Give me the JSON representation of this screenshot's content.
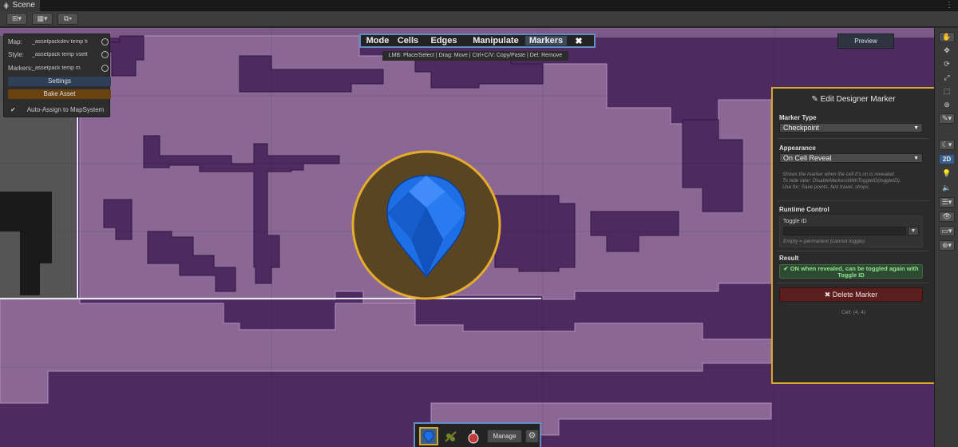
{
  "window": {
    "tab_title": "Scene",
    "tab_icon": "grid-icon",
    "menu_icon": "kebab-icon"
  },
  "map_panel": {
    "rows": [
      {
        "label": "Map:",
        "value": "_assetpackdev temp fi"
      },
      {
        "label": "Style:",
        "value": "_assetpack temp vsett"
      },
      {
        "label": "Markers:",
        "value": "_assetpack temp m"
      }
    ],
    "settings_label": "Settings",
    "bake_label": "Bake Asset",
    "auto_assign_label": "Auto-Assign to MapSystem",
    "auto_assign_checked": true
  },
  "mode_bar": {
    "items": [
      {
        "label": "Mode",
        "active": false
      },
      {
        "label": "Cells",
        "active": false
      },
      {
        "label": "Edges",
        "active": false
      },
      {
        "label": "Manipulate",
        "active": false
      },
      {
        "label": "Markers",
        "active": true
      }
    ],
    "close_label": "✖"
  },
  "hint": "LMB: Place/Select | Drag: Move | Ctrl+C/V: Copy/Paste | Del: Remove",
  "preview_label": "Preview",
  "edit_panel": {
    "title": "✎ Edit Designer Marker",
    "marker_type_label": "Marker Type",
    "marker_type_value": "Checkpoint",
    "appearance_label": "Appearance",
    "appearance_value": "On Cell Reveal",
    "help_lines": [
      "Shows the marker when the cell it's on is revealed.",
      "To hide later: DisableMarkersWithToggleID(toggleID).",
      "Use for: Save points, fast travel, shops."
    ],
    "runtime_label": "Runtime Control",
    "toggle_id_label": "Toggle ID",
    "toggle_id_value": "",
    "toggle_hint": "Empty = permanent (cannot toggle)",
    "result_label": "Result",
    "result_line1": "✔ ON when revealed, can be toggled again with",
    "result_line2": "Toggle ID",
    "delete_label": "✖ Delete Marker",
    "cell_info": "Cell: (4, 4)"
  },
  "tool_strip": {
    "tools": [
      "hand-icon",
      "move-icon",
      "rotate-icon",
      "scale-icon",
      "rect-tool-icon",
      "transform-icon",
      "brush-icon"
    ],
    "view_2d_label": "2D"
  },
  "bottom_bar": {
    "slots": [
      "map-pin-icon",
      "branch-icon",
      "potion-icon"
    ],
    "manage_label": "Manage",
    "gear_icon": "gear-icon"
  },
  "colors": {
    "map_room": "#8a6795",
    "map_wall": "#4d2a60",
    "accent_gold": "#d9a62c",
    "accent_blue": "#5f8dc4",
    "marker_gem": "#1e6fe6"
  }
}
